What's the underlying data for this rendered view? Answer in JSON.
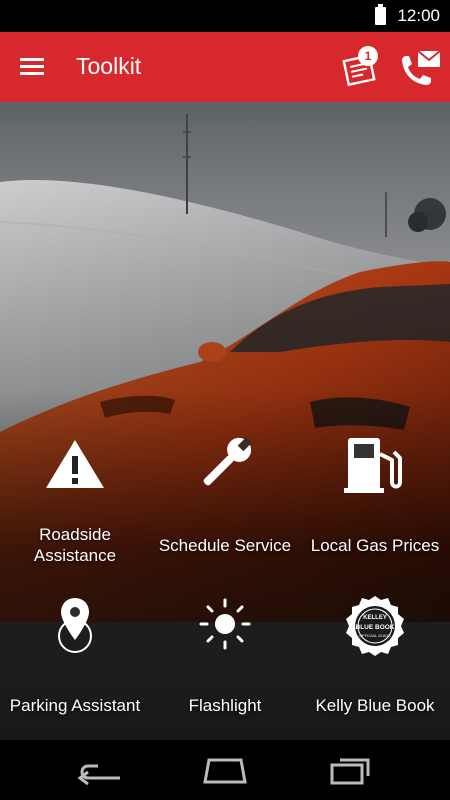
{
  "status_bar": {
    "time": "12:00"
  },
  "app_bar": {
    "title": "Toolkit",
    "notifications_badge": "1",
    "accent_color": "#d7282d"
  },
  "tiles": [
    {
      "label": "Roadside\nAssistance",
      "icon": "warning-triangle-icon"
    },
    {
      "label": "Schedule Service",
      "icon": "wrench-icon"
    },
    {
      "label": "Local Gas Prices",
      "icon": "gas-pump-icon"
    },
    {
      "label": "Parking Assistant",
      "icon": "map-pin-icon"
    },
    {
      "label": "Flashlight",
      "icon": "sun-icon"
    },
    {
      "label": "Kelly Blue Book",
      "icon": "kelley-blue-book-icon"
    }
  ],
  "kbb_badge": {
    "line1": "KELLEY",
    "line2": "BLUE BOOK",
    "line3": "OFFICIAL GUIDE"
  },
  "nav_bar": {
    "buttons": [
      "back-icon",
      "home-icon",
      "recent-apps-icon"
    ]
  }
}
